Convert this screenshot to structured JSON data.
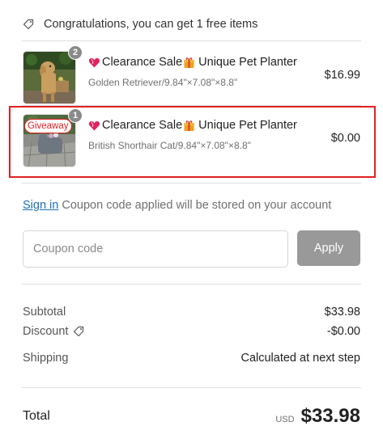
{
  "promo": {
    "text": "Congratulations, you can get 1 free items",
    "icon": "tag-icon"
  },
  "items": [
    {
      "name": "Clearance Sale",
      "name_suffix": "Unique Pet Planter",
      "variant": "Golden Retriever/9.84\"×7.08\"×8.8\"",
      "price": "$16.99",
      "quantity": "2",
      "badge": ""
    },
    {
      "name": "Clearance Sale",
      "name_suffix": "Unique Pet Planter",
      "variant": "British Shorthair Cat/9.84\"×7.08\"×8.8\"",
      "price": "$0.00",
      "quantity": "1",
      "badge": "Giveaway"
    }
  ],
  "signin": {
    "link_text": "Sign in",
    "message": "Coupon code applied will be stored on your account"
  },
  "coupon": {
    "placeholder": "Coupon code",
    "value": "",
    "apply_label": "Apply"
  },
  "summary": {
    "subtotal_label": "Subtotal",
    "subtotal_value": "$33.98",
    "discount_label": "Discount",
    "discount_value": "-$0.00",
    "shipping_label": "Shipping",
    "shipping_value": "Calculated at next step"
  },
  "total": {
    "label": "Total",
    "currency": "USD",
    "amount": "$33.98"
  },
  "colors": {
    "link": "#1f6fb5",
    "highlight": "#e02020",
    "apply_button": "#999999"
  }
}
